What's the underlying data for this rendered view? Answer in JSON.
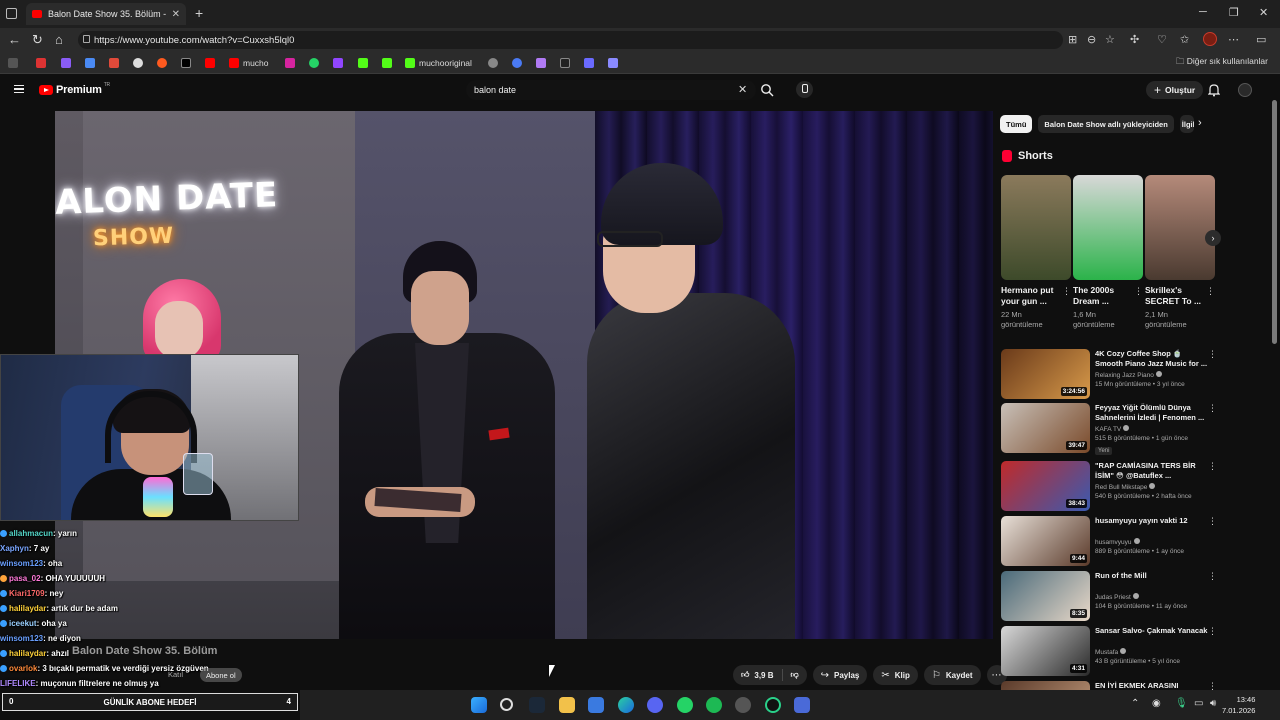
{
  "browser": {
    "tab_title": "Balon Date Show 35. Bölüm - YouTube",
    "url": "https://www.youtube.com/watch?v=Cuxxsh5lql0",
    "bookmarks": [
      "mucho",
      "muchooriginal"
    ],
    "other_bookmarks": "Diğer sık kullanılanlar"
  },
  "youtube": {
    "logo_text": "Premium",
    "logo_region": "TR",
    "search_value": "balon date",
    "create_label": "Oluştur"
  },
  "video": {
    "neon_line1": "ALON DATE",
    "neon_line2": "SHOW",
    "title_overlay": "Balon Date Show 35. Bölüm",
    "join_ghost": "Katıl",
    "subscribe_ghost": "Abone ol",
    "likes": "3,9 B",
    "share_label": "Paylaş",
    "clip_label": "Klip",
    "save_label": "Kaydet"
  },
  "chat": [
    {
      "user": "allahmacun",
      "msg": ": yarın",
      "color": "#54d6c8",
      "badge": "#3aa0ff"
    },
    {
      "user": "Xaphyn",
      "msg": ": 7 ay",
      "color": "#7aa6ff",
      "badge": ""
    },
    {
      "user": "winsom123",
      "msg": ": oha",
      "color": "#6aa0ff",
      "badge": ""
    },
    {
      "user": "pasa_02",
      "msg": ": OHA YUUUUUH",
      "color": "#ff7ad9",
      "badge": "#ffa43a"
    },
    {
      "user": "Kiari1709",
      "msg": ": ney",
      "color": "#ff6a6a",
      "badge": "#3aa0ff"
    },
    {
      "user": "halilaydar",
      "msg": ": artık dur be adam",
      "color": "#ffd23a",
      "badge": "#3aa0ff"
    },
    {
      "user": "iceekut",
      "msg": ": oha ya",
      "color": "#9ad0ff",
      "badge": "#3aa0ff"
    },
    {
      "user": "winsom123",
      "msg": ": ne diyon",
      "color": "#6aa0ff",
      "badge": ""
    },
    {
      "user": "halilaydar",
      "msg": ": ahzıl",
      "color": "#ffd23a",
      "badge": "#3aa0ff"
    },
    {
      "user": "ovarlok",
      "msg": ": 3 bıçaklı permatik ve verdiği yersiz özgüven",
      "color": "#ff8a3a",
      "badge": "#3aa0ff"
    },
    {
      "user": "LIFELIKE",
      "msg": ": muçonun filtrelere ne olmuş ya",
      "color": "#b08aff",
      "badge": ""
    }
  ],
  "goal_bar": {
    "left": "0",
    "label": "GÜNLİK ABONE HEDEFİ",
    "right": "4"
  },
  "chips": [
    "Tümü",
    "Balon Date Show adlı yükleyiciden",
    "İlgili"
  ],
  "shorts": {
    "heading": "Shorts",
    "items": [
      {
        "title": "Hermano put your gun ...",
        "views": "22 Mn görüntüleme",
        "color1": "#8b7a5c",
        "color2": "#3d4a2a"
      },
      {
        "title": "The 2000s Dream ...",
        "views": "1,6 Mn görüntüleme",
        "color1": "#d8d8d8",
        "color2": "#2bb34a"
      },
      {
        "title": "Skrillex's SECRET To ...",
        "views": "2,1 Mn görüntüleme",
        "color1": "#b58a7a",
        "color2": "#4a3a30"
      }
    ]
  },
  "recommendations": [
    {
      "title": "4K Cozy Coffee Shop 🍵 Smooth Piano Jazz Music for ...",
      "channel": "Relaxing Jazz Piano",
      "meta": "15 Mn görüntüleme • 3 yıl önce",
      "duration": "3:24:56",
      "new": "",
      "color1": "#6a3a1a",
      "color2": "#d89a4a"
    },
    {
      "title": "Feyyaz Yiğit Ölümlü Dünya Sahnelerini İzledi | Fenomen ...",
      "channel": "KAFA TV",
      "meta": "515 B görüntüleme • 1 gün önce",
      "duration": "39:47",
      "new": "Yeni",
      "color1": "#c8c0b8",
      "color2": "#7a4a2a"
    },
    {
      "title": "\"RAP CAMİASINA TERS BİR İSİM\" 😳 @Batuflex ...",
      "channel": "Red Bull Mikstape",
      "meta": "540 B görüntüleme • 2 hafta önce",
      "duration": "38:43",
      "new": "",
      "color1": "#c02a2a",
      "color2": "#3a5ab0"
    },
    {
      "title": "husamyuyu yayın vakti 12",
      "channel": "husamvyuyu",
      "meta": "889 B görüntüleme • 1 ay önce",
      "duration": "9:44",
      "new": "",
      "color1": "#e8e0d8",
      "color2": "#5a3a2a"
    },
    {
      "title": "Run of the Mill",
      "channel": "Judas Priest",
      "meta": "104 B görüntüleme • 11 ay önce",
      "duration": "8:35",
      "new": "",
      "color1": "#4a6a7a",
      "color2": "#e8d8c8"
    },
    {
      "title": "Sansar Salvo- Çakmak Yanacak",
      "channel": "Mustafa",
      "meta": "43 B görüntüleme • 5 yıl önce",
      "duration": "4:31",
      "new": "",
      "color1": "#d8d8d8",
      "color2": "#2a2a2a"
    },
    {
      "title": "EN İYİ EKMEK ARASINI",
      "channel": "",
      "meta": "",
      "duration": "",
      "new": "",
      "color1": "#5a3a2a",
      "color2": "#c8a080"
    }
  ],
  "clock": {
    "time": "13:46",
    "date": "7.01.2026"
  }
}
